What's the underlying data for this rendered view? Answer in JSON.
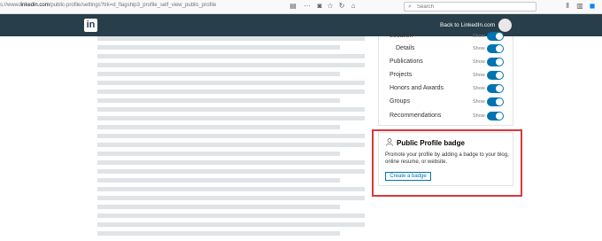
{
  "browser": {
    "url_prefix": "s://www.",
    "url_domain": "linkedin.com",
    "url_path": "/public-profile/settings?trk=d_flagship3_profile_self_view_public_profile",
    "search_placeholder": "Search"
  },
  "header": {
    "logo_text": "in",
    "back_link": "Back to LinkedIn.com"
  },
  "settings": {
    "rows": [
      {
        "label": "Location",
        "state": "Show"
      },
      {
        "label": "Details",
        "state": "Show"
      },
      {
        "label": "Publications",
        "state": "Show"
      },
      {
        "label": "Projects",
        "state": "Show"
      },
      {
        "label": "Honors and Awards",
        "state": "Show"
      },
      {
        "label": "Groups",
        "state": "Show"
      },
      {
        "label": "Recommendations",
        "state": "Show"
      }
    ]
  },
  "badge": {
    "title": "Public Profile badge",
    "description": "Promote your profile by adding a badge to your blog, online resume, or website.",
    "button_label": "Create a badge"
  },
  "colors": {
    "header_bg": "#283e4a",
    "toggle_on": "#0073b1",
    "highlight": "#d9383a"
  }
}
